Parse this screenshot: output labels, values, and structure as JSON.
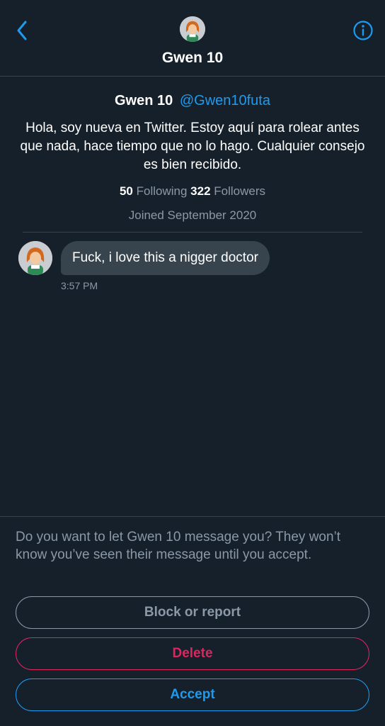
{
  "header": {
    "title": "Gwen 10",
    "icons": {
      "back": "chevron-left-icon",
      "info": "info-icon"
    }
  },
  "profile": {
    "name": "Gwen 10",
    "handle": "@Gwen10futa",
    "bio": "Hola, soy nueva en Twitter. Estoy aquí para rolear antes que nada, hace tiempo que no lo hago. Cualquier consejo es bien recibido.",
    "following_count": "50",
    "following_label": "Following",
    "followers_count": "322",
    "followers_label": "Followers",
    "joined": "Joined September 2020"
  },
  "message": {
    "text": "Fuck, i love this a nigger doctor",
    "time": "3:57 PM"
  },
  "request": {
    "prompt": "Do you want to let Gwen 10 message you? They won’t know you’ve seen their message until you accept.",
    "block_label": "Block or report",
    "delete_label": "Delete",
    "accept_label": "Accept"
  },
  "colors": {
    "background": "#15202b",
    "accent": "#1d9bf0",
    "danger": "#e0245e",
    "muted": "#8b98a5",
    "bubble": "#38444d"
  }
}
